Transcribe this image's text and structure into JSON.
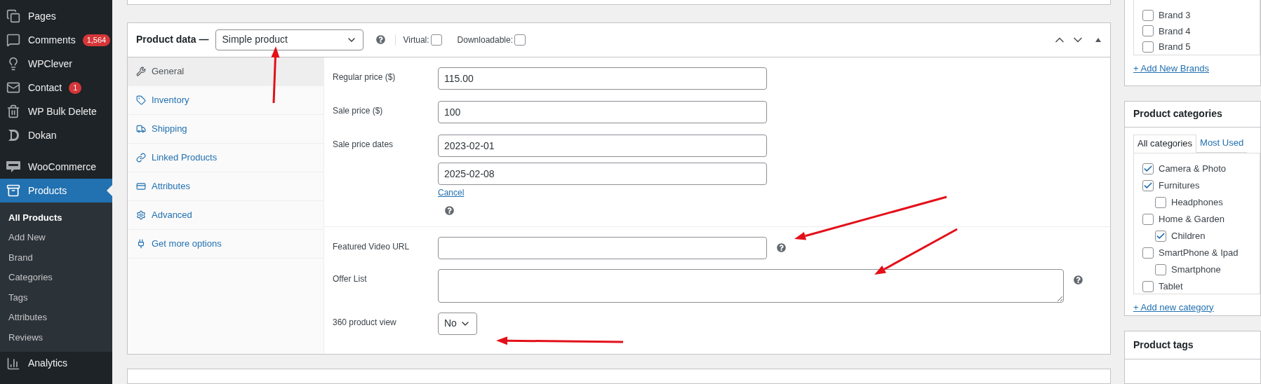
{
  "sidebar": {
    "items": [
      {
        "label": "Pages",
        "selected": false
      },
      {
        "label": "Comments",
        "badge": "1,564",
        "selected": false
      },
      {
        "label": "WPClever",
        "selected": false
      },
      {
        "label": "Contact",
        "badge": "1",
        "selected": false
      },
      {
        "label": "WP Bulk Delete",
        "selected": false
      },
      {
        "label": "Dokan",
        "selected": false
      },
      {
        "label": "WooCommerce",
        "selected": false
      },
      {
        "label": "Products",
        "selected": true,
        "submenu": [
          {
            "label": "All Products",
            "selected": true
          },
          {
            "label": "Add New",
            "selected": false
          },
          {
            "label": "Brand",
            "selected": false
          },
          {
            "label": "Categories",
            "selected": false
          },
          {
            "label": "Tags",
            "selected": false
          },
          {
            "label": "Attributes",
            "selected": false
          },
          {
            "label": "Reviews",
            "selected": false
          }
        ]
      },
      {
        "label": "Analytics",
        "selected": false
      }
    ]
  },
  "product_data": {
    "title": "Product data —",
    "type": "Simple product",
    "options": [
      {
        "label": "Virtual:",
        "checked": false
      },
      {
        "label": "Downloadable:",
        "checked": false
      }
    ],
    "tabs": [
      {
        "label": "General",
        "selected": true
      },
      {
        "label": "Inventory",
        "selected": false
      },
      {
        "label": "Shipping",
        "selected": false
      },
      {
        "label": "Linked Products",
        "selected": false
      },
      {
        "label": "Attributes",
        "selected": false
      },
      {
        "label": "Advanced",
        "selected": false
      },
      {
        "label": "Get more options",
        "selected": false
      }
    ],
    "pricing": [
      {
        "kind": "text",
        "label": "Regular price ($)",
        "value": "115.00",
        "help": false
      },
      {
        "kind": "text",
        "label": "Sale price ($)",
        "value": "100",
        "help": false
      },
      {
        "kind": "dates",
        "label": "Sale price dates",
        "values": [
          "2023-02-01",
          "2025-02-08"
        ],
        "cancel": "Cancel",
        "help": true
      }
    ],
    "extra": [
      {
        "kind": "text",
        "label": "Featured Video URL",
        "help": true
      },
      {
        "kind": "textarea",
        "label": "Offer List",
        "help": true
      },
      {
        "kind": "select",
        "label": "360 product view",
        "value": "No",
        "help": false
      }
    ]
  },
  "brands": {
    "items": [
      {
        "label": "Brand 3",
        "checked": false
      },
      {
        "label": "Brand 4",
        "checked": false
      },
      {
        "label": "Brand 5",
        "checked": false
      }
    ],
    "add_link": "+ Add New Brands"
  },
  "categories": {
    "title": "Product categories",
    "tabs": [
      {
        "label": "All categories",
        "selected": true
      },
      {
        "label": "Most Used",
        "selected": false
      }
    ],
    "items": [
      {
        "label": "Camera & Photo",
        "checked": true
      },
      {
        "label": "Furnitures",
        "checked": true,
        "children": [
          {
            "label": "Headphones",
            "checked": false
          }
        ]
      },
      {
        "label": "Home & Garden",
        "checked": false,
        "children": [
          {
            "label": "Children",
            "checked": true
          }
        ]
      },
      {
        "label": "SmartPhone & Ipad",
        "checked": false,
        "children": [
          {
            "label": "Smartphone",
            "checked": false
          }
        ]
      },
      {
        "label": "Tablet",
        "checked": false
      }
    ],
    "add_link": "+ Add new category"
  },
  "tags": {
    "title": "Product tags"
  }
}
